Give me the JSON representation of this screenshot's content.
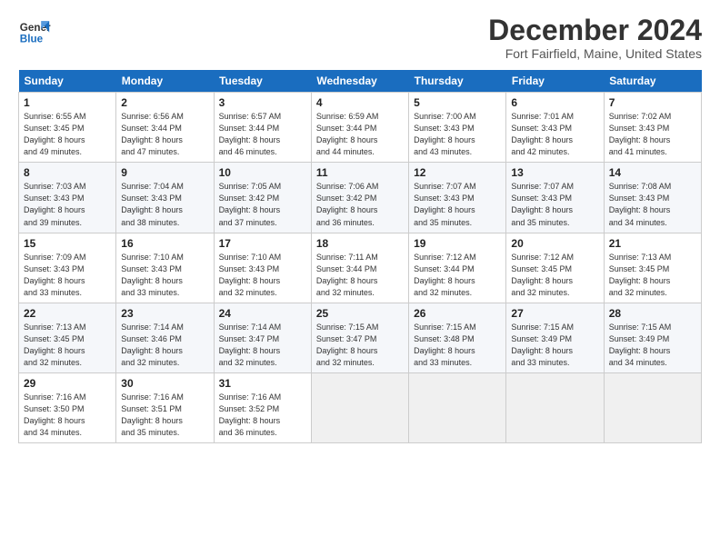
{
  "logo": {
    "line1": "General",
    "line2": "Blue"
  },
  "title": "December 2024",
  "location": "Fort Fairfield, Maine, United States",
  "days_of_week": [
    "Sunday",
    "Monday",
    "Tuesday",
    "Wednesday",
    "Thursday",
    "Friday",
    "Saturday"
  ],
  "weeks": [
    [
      {
        "day": "1",
        "info": "Sunrise: 6:55 AM\nSunset: 3:45 PM\nDaylight: 8 hours\nand 49 minutes."
      },
      {
        "day": "2",
        "info": "Sunrise: 6:56 AM\nSunset: 3:44 PM\nDaylight: 8 hours\nand 47 minutes."
      },
      {
        "day": "3",
        "info": "Sunrise: 6:57 AM\nSunset: 3:44 PM\nDaylight: 8 hours\nand 46 minutes."
      },
      {
        "day": "4",
        "info": "Sunrise: 6:59 AM\nSunset: 3:44 PM\nDaylight: 8 hours\nand 44 minutes."
      },
      {
        "day": "5",
        "info": "Sunrise: 7:00 AM\nSunset: 3:43 PM\nDaylight: 8 hours\nand 43 minutes."
      },
      {
        "day": "6",
        "info": "Sunrise: 7:01 AM\nSunset: 3:43 PM\nDaylight: 8 hours\nand 42 minutes."
      },
      {
        "day": "7",
        "info": "Sunrise: 7:02 AM\nSunset: 3:43 PM\nDaylight: 8 hours\nand 41 minutes."
      }
    ],
    [
      {
        "day": "8",
        "info": "Sunrise: 7:03 AM\nSunset: 3:43 PM\nDaylight: 8 hours\nand 39 minutes."
      },
      {
        "day": "9",
        "info": "Sunrise: 7:04 AM\nSunset: 3:43 PM\nDaylight: 8 hours\nand 38 minutes."
      },
      {
        "day": "10",
        "info": "Sunrise: 7:05 AM\nSunset: 3:42 PM\nDaylight: 8 hours\nand 37 minutes."
      },
      {
        "day": "11",
        "info": "Sunrise: 7:06 AM\nSunset: 3:42 PM\nDaylight: 8 hours\nand 36 minutes."
      },
      {
        "day": "12",
        "info": "Sunrise: 7:07 AM\nSunset: 3:43 PM\nDaylight: 8 hours\nand 35 minutes."
      },
      {
        "day": "13",
        "info": "Sunrise: 7:07 AM\nSunset: 3:43 PM\nDaylight: 8 hours\nand 35 minutes."
      },
      {
        "day": "14",
        "info": "Sunrise: 7:08 AM\nSunset: 3:43 PM\nDaylight: 8 hours\nand 34 minutes."
      }
    ],
    [
      {
        "day": "15",
        "info": "Sunrise: 7:09 AM\nSunset: 3:43 PM\nDaylight: 8 hours\nand 33 minutes."
      },
      {
        "day": "16",
        "info": "Sunrise: 7:10 AM\nSunset: 3:43 PM\nDaylight: 8 hours\nand 33 minutes."
      },
      {
        "day": "17",
        "info": "Sunrise: 7:10 AM\nSunset: 3:43 PM\nDaylight: 8 hours\nand 32 minutes."
      },
      {
        "day": "18",
        "info": "Sunrise: 7:11 AM\nSunset: 3:44 PM\nDaylight: 8 hours\nand 32 minutes."
      },
      {
        "day": "19",
        "info": "Sunrise: 7:12 AM\nSunset: 3:44 PM\nDaylight: 8 hours\nand 32 minutes."
      },
      {
        "day": "20",
        "info": "Sunrise: 7:12 AM\nSunset: 3:45 PM\nDaylight: 8 hours\nand 32 minutes."
      },
      {
        "day": "21",
        "info": "Sunrise: 7:13 AM\nSunset: 3:45 PM\nDaylight: 8 hours\nand 32 minutes."
      }
    ],
    [
      {
        "day": "22",
        "info": "Sunrise: 7:13 AM\nSunset: 3:45 PM\nDaylight: 8 hours\nand 32 minutes."
      },
      {
        "day": "23",
        "info": "Sunrise: 7:14 AM\nSunset: 3:46 PM\nDaylight: 8 hours\nand 32 minutes."
      },
      {
        "day": "24",
        "info": "Sunrise: 7:14 AM\nSunset: 3:47 PM\nDaylight: 8 hours\nand 32 minutes."
      },
      {
        "day": "25",
        "info": "Sunrise: 7:15 AM\nSunset: 3:47 PM\nDaylight: 8 hours\nand 32 minutes."
      },
      {
        "day": "26",
        "info": "Sunrise: 7:15 AM\nSunset: 3:48 PM\nDaylight: 8 hours\nand 33 minutes."
      },
      {
        "day": "27",
        "info": "Sunrise: 7:15 AM\nSunset: 3:49 PM\nDaylight: 8 hours\nand 33 minutes."
      },
      {
        "day": "28",
        "info": "Sunrise: 7:15 AM\nSunset: 3:49 PM\nDaylight: 8 hours\nand 34 minutes."
      }
    ],
    [
      {
        "day": "29",
        "info": "Sunrise: 7:16 AM\nSunset: 3:50 PM\nDaylight: 8 hours\nand 34 minutes."
      },
      {
        "day": "30",
        "info": "Sunrise: 7:16 AM\nSunset: 3:51 PM\nDaylight: 8 hours\nand 35 minutes."
      },
      {
        "day": "31",
        "info": "Sunrise: 7:16 AM\nSunset: 3:52 PM\nDaylight: 8 hours\nand 36 minutes."
      },
      {
        "day": "",
        "info": ""
      },
      {
        "day": "",
        "info": ""
      },
      {
        "day": "",
        "info": ""
      },
      {
        "day": "",
        "info": ""
      }
    ]
  ]
}
